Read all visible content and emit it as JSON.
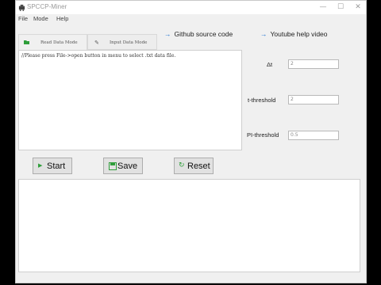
{
  "window": {
    "title": "SPCCP-Miner",
    "min_glyph": "—",
    "max_glyph": "☐",
    "close_glyph": "✕"
  },
  "menu": {
    "items": [
      "File",
      "Mode",
      "Help"
    ]
  },
  "tabs": [
    {
      "label": "Read Data Mode",
      "icon": "open-file-icon"
    },
    {
      "label": "Input Data Mode",
      "icon": "pencil-icon"
    }
  ],
  "data_text": {
    "hint": "//Please press File->open button in menu to select .txt data file."
  },
  "links": {
    "github": "Github source code",
    "youtube": "Youtube help video",
    "arrow_color": "#1a6fd0"
  },
  "params": {
    "delta_t_label": "Δt",
    "delta_t_value": "2",
    "t_threshold_label": "t-threshold",
    "t_threshold_value": "2",
    "pi_threshold_label": "PI-threshold",
    "pi_threshold_value": "0.5"
  },
  "buttons": {
    "start": "Start",
    "save": "Save",
    "reset": "Reset",
    "start_icon_color": "#2e9e3a",
    "save_icon_color": "#2e9e3a",
    "reset_icon_color": "#2e9e3a"
  }
}
